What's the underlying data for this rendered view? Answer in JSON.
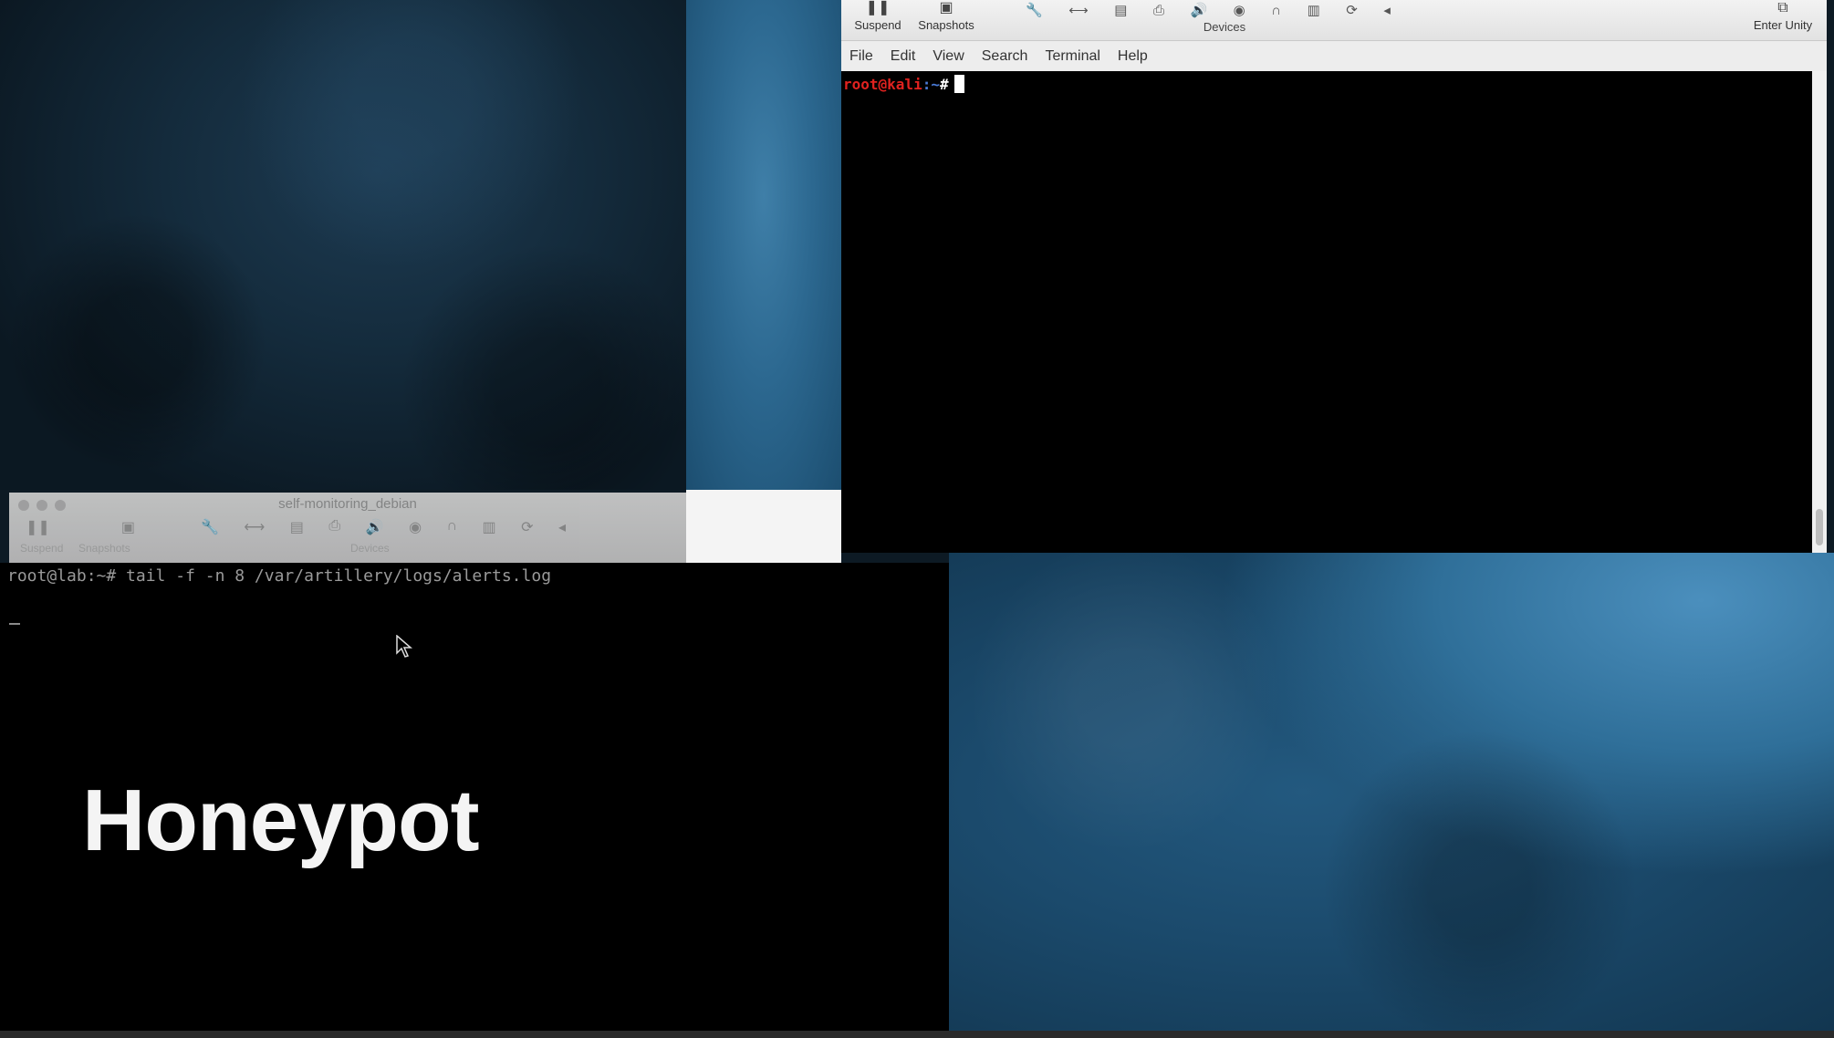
{
  "overlay_title": "Honeypot",
  "kali_window": {
    "toolbar": {
      "suspend_label": "Suspend",
      "snapshots_label": "Snapshots",
      "devices_label": "Devices",
      "enter_unity_label": "Enter Unity"
    },
    "menu": [
      "File",
      "Edit",
      "View",
      "Search",
      "Terminal",
      "Help"
    ],
    "prompt": {
      "user_host": "root@kali",
      "path": ":~",
      "symbol": "#"
    }
  },
  "debian_window": {
    "title": "self-monitoring_debian",
    "toolbar_sub": {
      "suspend_label": "Suspend",
      "snapshots_label": "Snapshots",
      "devices_label": "Devices"
    },
    "command_line": "root@lab:~# tail -f -n 8 /var/artillery/logs/alerts.log"
  }
}
